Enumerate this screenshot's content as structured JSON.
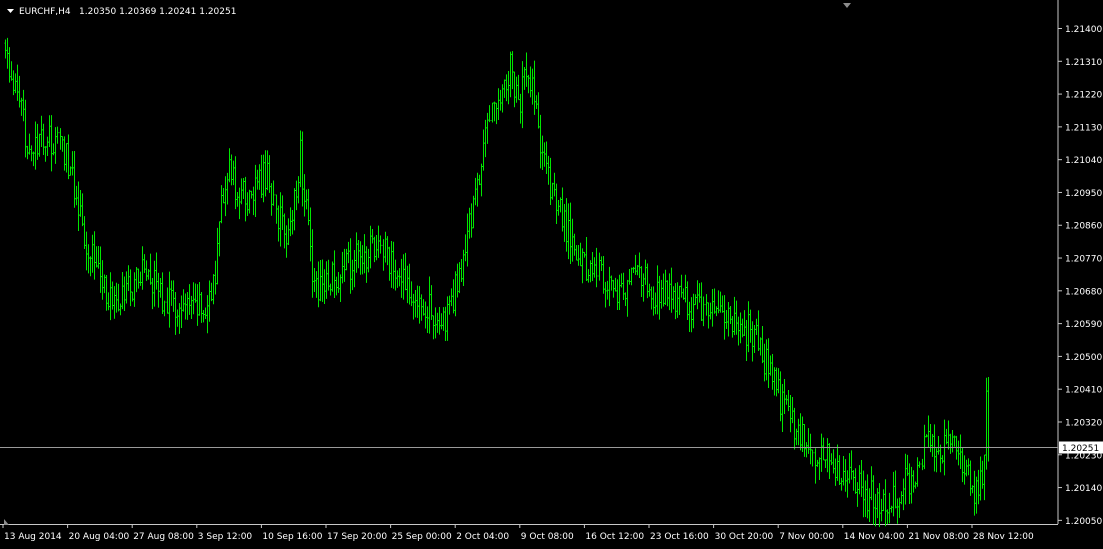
{
  "header": {
    "symbol": "EURCHF,H4",
    "ohlc": "1.20350 1.20369 1.20241 1.20251"
  },
  "colors": {
    "background": "#000000",
    "bars": "#00e600",
    "axis": "#c8c8c8",
    "text": "#ffffff",
    "bid_line": "#9a9a9a",
    "price_box_bg": "#ffffff",
    "price_box_text": "#000000"
  },
  "chart_data": {
    "type": "ohlc-bar",
    "title": "EURCHF,H4",
    "timeframe": "H4",
    "bid_price": "1.20251",
    "ylim": [
      1.2004,
      1.2147
    ],
    "y_ticks": [
      "1.21400",
      "1.21310",
      "1.21220",
      "1.21130",
      "1.21040",
      "1.20950",
      "1.20860",
      "1.20770",
      "1.20680",
      "1.20590",
      "1.20500",
      "1.20410",
      "1.20320",
      "1.20230",
      "1.20140",
      "1.20050"
    ],
    "x_ticks": [
      "13 Aug 2014",
      "20 Aug 04:00",
      "27 Aug 08:00",
      "3 Sep 12:00",
      "10 Sep 16:00",
      "17 Sep 20:00",
      "25 Sep 00:00",
      "2 Oct 04:00",
      "9 Oct 08:00",
      "16 Oct 12:00",
      "23 Oct 16:00",
      "30 Oct 20:00",
      "7 Nov 00:00",
      "14 Nov 04:00",
      "21 Nov 08:00",
      "28 Nov 12:00"
    ],
    "bars_per_tick": 32,
    "close_anchors": [
      [
        0,
        1.2134
      ],
      [
        6,
        1.212
      ],
      [
        10,
        1.2112
      ],
      [
        14,
        1.2105
      ],
      [
        20,
        1.211
      ],
      [
        26,
        1.2108
      ],
      [
        30,
        1.2106
      ],
      [
        36,
        1.2092
      ],
      [
        40,
        1.2082
      ],
      [
        44,
        1.2078
      ],
      [
        50,
        1.2068
      ],
      [
        54,
        1.2063
      ],
      [
        60,
        1.2068
      ],
      [
        66,
        1.2072
      ],
      [
        70,
        1.2075
      ],
      [
        76,
        1.2068
      ],
      [
        82,
        1.2064
      ],
      [
        90,
        1.2062
      ],
      [
        100,
        1.2064
      ],
      [
        104,
        1.207
      ],
      [
        106,
        1.209
      ],
      [
        110,
        1.2102
      ],
      [
        116,
        1.2094
      ],
      [
        120,
        1.2093
      ],
      [
        126,
        1.2098
      ],
      [
        130,
        1.21
      ],
      [
        134,
        1.209
      ],
      [
        140,
        1.2082
      ],
      [
        146,
        1.2106
      ],
      [
        152,
        1.2072
      ],
      [
        156,
        1.2068
      ],
      [
        162,
        1.2071
      ],
      [
        170,
        1.2075
      ],
      [
        178,
        1.2078
      ],
      [
        186,
        1.208
      ],
      [
        192,
        1.2074
      ],
      [
        198,
        1.207
      ],
      [
        206,
        1.2066
      ],
      [
        212,
        1.2062
      ],
      [
        218,
        1.2058
      ],
      [
        222,
        1.2066
      ],
      [
        226,
        1.2075
      ],
      [
        230,
        1.2085
      ],
      [
        234,
        1.2098
      ],
      [
        238,
        1.211
      ],
      [
        242,
        1.2118
      ],
      [
        246,
        1.2125
      ],
      [
        250,
        1.213
      ],
      [
        254,
        1.2118
      ],
      [
        258,
        1.2128
      ],
      [
        262,
        1.212
      ],
      [
        266,
        1.2105
      ],
      [
        270,
        1.2095
      ],
      [
        274,
        1.209
      ],
      [
        278,
        1.2085
      ],
      [
        282,
        1.2078
      ],
      [
        290,
        1.2074
      ],
      [
        300,
        1.207
      ],
      [
        306,
        1.2067
      ],
      [
        312,
        1.2074
      ],
      [
        320,
        1.2068
      ],
      [
        330,
        1.2066
      ],
      [
        340,
        1.2064
      ],
      [
        350,
        1.2062
      ],
      [
        360,
        1.206
      ],
      [
        366,
        1.2058
      ],
      [
        372,
        1.2055
      ],
      [
        378,
        1.2046
      ],
      [
        384,
        1.2038
      ],
      [
        390,
        1.2032
      ],
      [
        396,
        1.2026
      ],
      [
        402,
        1.2022
      ],
      [
        408,
        1.2022
      ],
      [
        414,
        1.2018
      ],
      [
        420,
        1.2015
      ],
      [
        426,
        1.2012
      ],
      [
        432,
        1.2011
      ],
      [
        438,
        1.201
      ],
      [
        444,
        1.2014
      ],
      [
        448,
        1.2016
      ],
      [
        452,
        1.202
      ],
      [
        456,
        1.2027
      ],
      [
        462,
        1.2026
      ],
      [
        468,
        1.2025
      ],
      [
        472,
        1.2027
      ],
      [
        476,
        1.2018
      ],
      [
        480,
        1.2014
      ],
      [
        484,
        1.2017
      ],
      [
        486,
        1.2036
      ],
      [
        487,
        1.2025
      ]
    ]
  }
}
